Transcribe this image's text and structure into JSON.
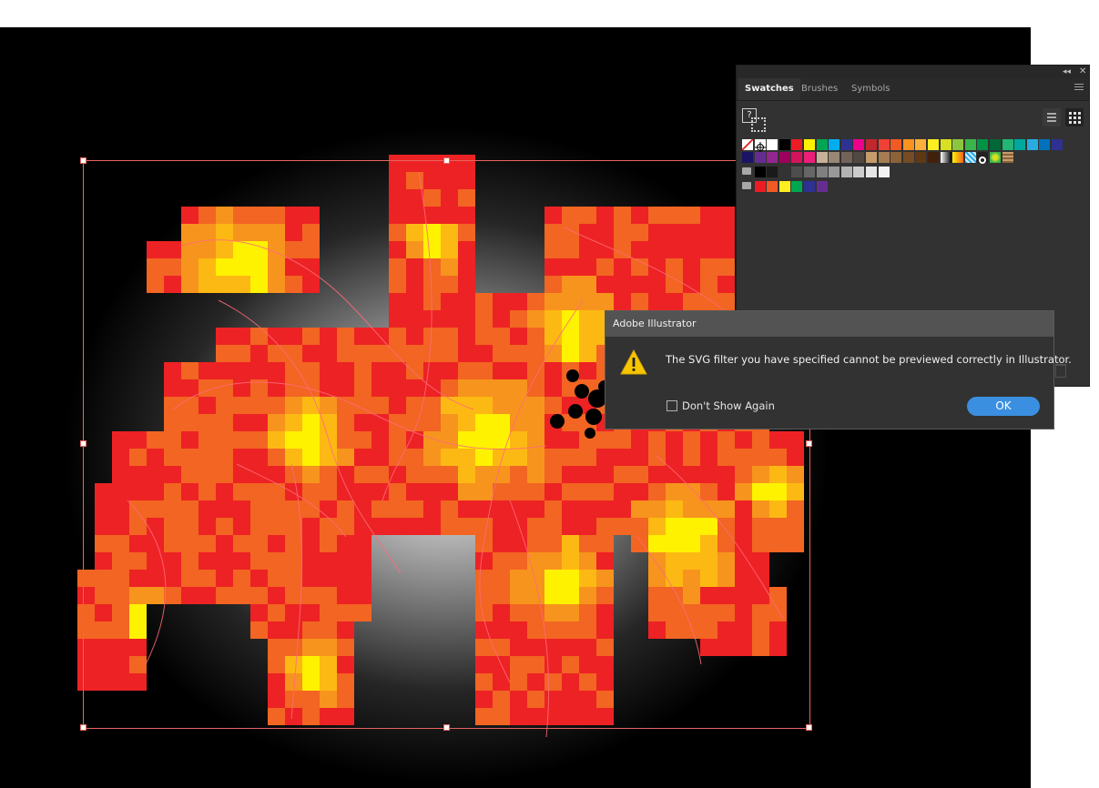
{
  "swatches_panel": {
    "tabs": [
      "Swatches",
      "Brushes",
      "Symbols"
    ],
    "active_tab": "Swatches",
    "collapse_icon": "double-chevron-left-icon",
    "close_icon": "close-icon",
    "menu_icon": "hamburger-menu-icon",
    "list_view_icon": "list-view-icon",
    "grid_view_icon": "grid-view-icon",
    "row1": [
      "none",
      "registration",
      "#ffffff",
      "#000000",
      "#ed1c24",
      "#fff200",
      "#00a651",
      "#00aeef",
      "#2e3192",
      "#ec008c",
      "#c1272d",
      "#ef4136",
      "#f15a24",
      "#f7931e",
      "#fbb03b",
      "#fcee21",
      "#d9e021",
      "#8cc63f",
      "#39b54a",
      "#009245",
      "#006837",
      "#22b573",
      "#00a99d",
      "#29abe2",
      "#0071bc",
      "#2e3192"
    ],
    "row2": [
      "#1b1464",
      "#662d91",
      "#93278f",
      "#9e005d",
      "#d4145a",
      "#ed1e79",
      "#c7b299",
      "#998675",
      "#736357",
      "#534741",
      "#c69c6d",
      "#a67c52",
      "#8c6239",
      "#754c24",
      "#603813",
      "#42210b",
      "gradient-bw",
      "gradient-orange",
      "pattern-blue",
      "pattern-circle",
      "pattern-leaf",
      "pattern-bark"
    ],
    "row3_group": [
      "#000000",
      "#1a1a1a",
      "#333333",
      "#4d4d4d",
      "#666666",
      "#808080",
      "#999999",
      "#b3b3b3",
      "#cccccc",
      "#e6e6e6",
      "#f2f2f2"
    ],
    "row4_group": [
      "#ed1c24",
      "#f15a24",
      "#fcee21",
      "#00a651",
      "#2e3192",
      "#662d91"
    ],
    "group_icon": "folder-icon"
  },
  "dialog": {
    "title": "Adobe Illustrator",
    "message": "The SVG filter you have specified cannot be previewed correctly in Illustrator.",
    "checkbox_label": "Don't Show Again",
    "checkbox_checked": false,
    "ok_label": "OK",
    "icon": "warning-icon",
    "accent": "#3a8fe0"
  },
  "canvas": {
    "artwork": "pixelated-flame-crab-artwork",
    "palette": [
      "#ed2224",
      "#f26522",
      "#f7941d",
      "#fdb913",
      "#fff200"
    ]
  }
}
